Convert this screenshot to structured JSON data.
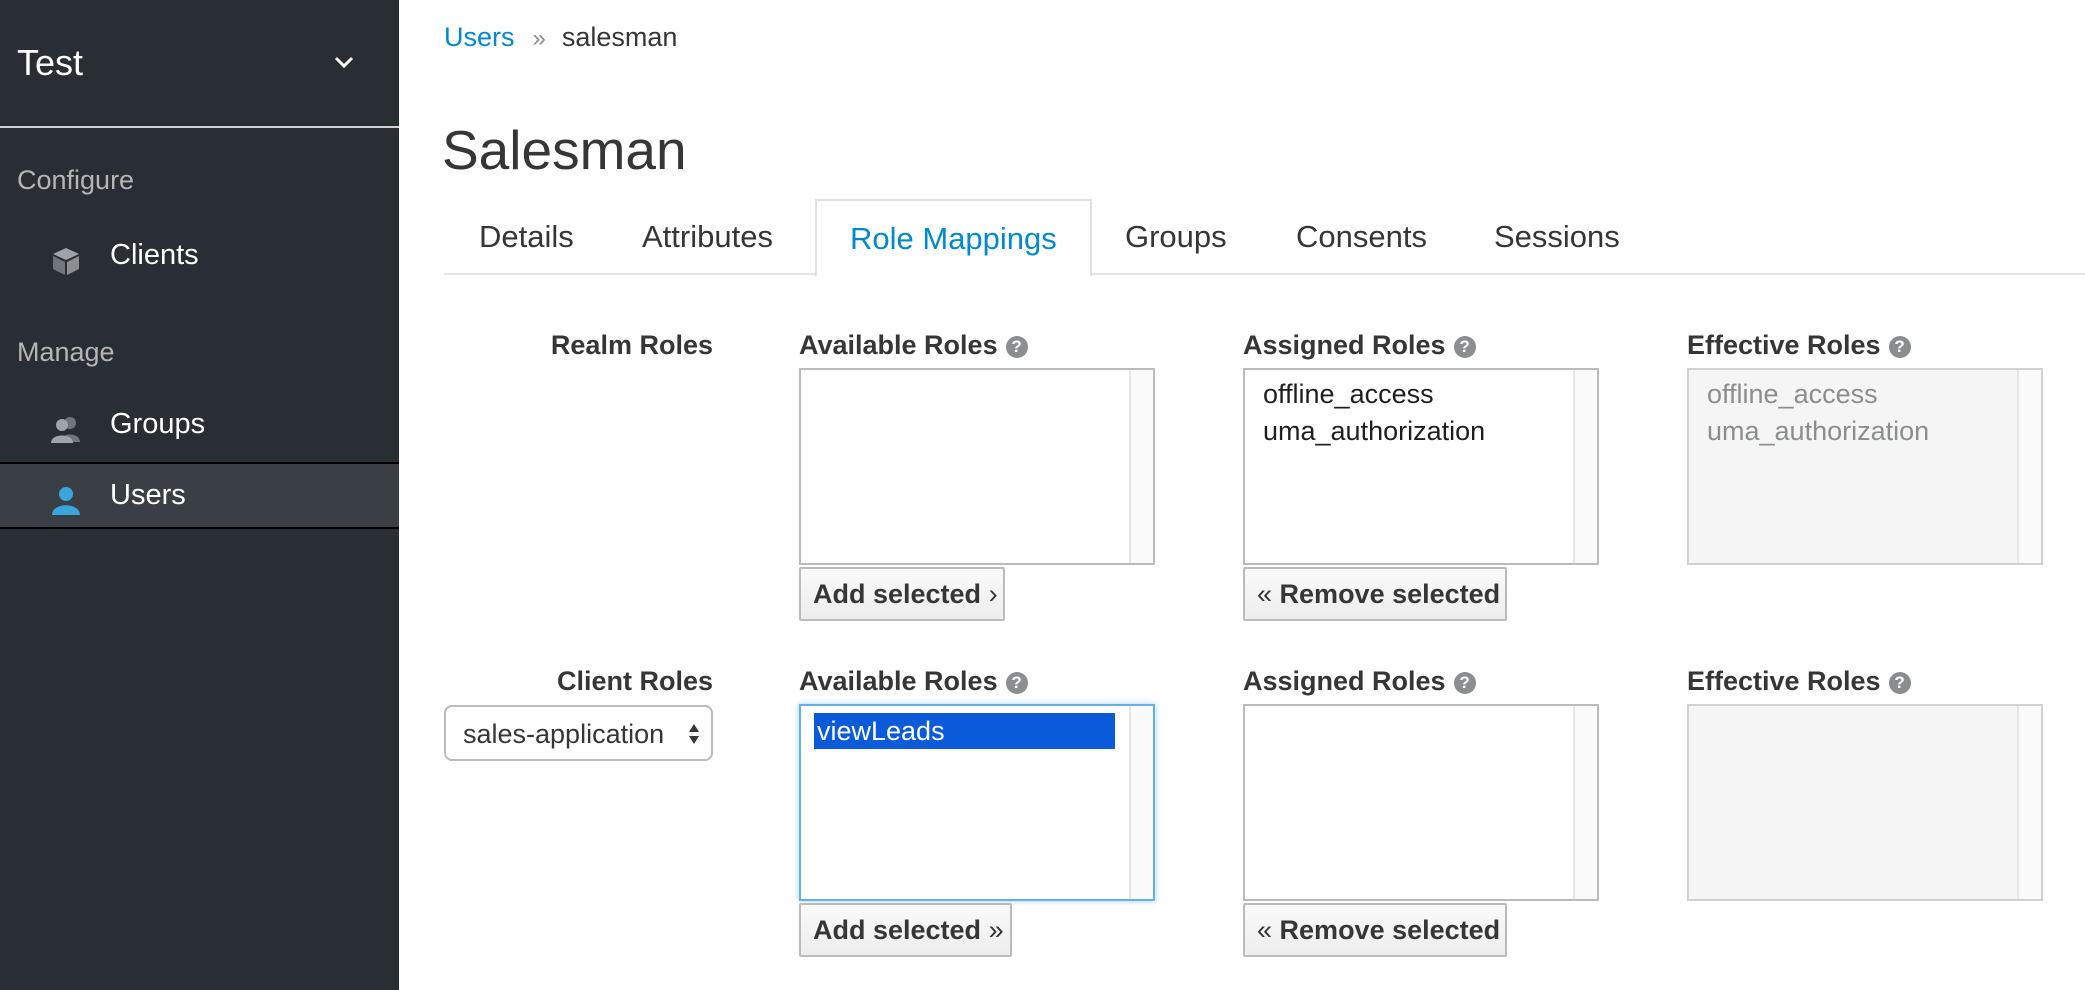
{
  "realm": {
    "name": "Test"
  },
  "nav": {
    "configure_heading": "Configure",
    "manage_heading": "Manage",
    "items": [
      {
        "label": "Clients",
        "icon": "cube-icon"
      },
      {
        "label": "Groups",
        "icon": "users-icon"
      },
      {
        "label": "Users",
        "icon": "user-icon",
        "active": true
      }
    ]
  },
  "breadcrumb": {
    "parent": "Users",
    "separator": "»",
    "current": "salesman"
  },
  "page_title": "Salesman",
  "tabs": [
    "Details",
    "Attributes",
    "Role Mappings",
    "Groups",
    "Consents",
    "Sessions"
  ],
  "active_tab": "Role Mappings",
  "help_glyph": "?",
  "realm_roles": {
    "label": "Realm Roles",
    "available": {
      "label": "Available Roles",
      "items": []
    },
    "assigned": {
      "label": "Assigned Roles",
      "items": [
        "offline_access",
        "uma_authorization"
      ]
    },
    "effective": {
      "label": "Effective Roles",
      "items": [
        "offline_access",
        "uma_authorization"
      ]
    },
    "add_button": {
      "label": "Add selected",
      "glyph": "›"
    },
    "remove_button": {
      "label": "Remove selected",
      "glyph": "«"
    }
  },
  "client_roles": {
    "label": "Client Roles",
    "client_select": {
      "value": "sales-application"
    },
    "available": {
      "label": "Available Roles",
      "items": [
        "viewLeads"
      ],
      "selected": "viewLeads"
    },
    "assigned": {
      "label": "Assigned Roles",
      "items": []
    },
    "effective": {
      "label": "Effective Roles",
      "items": []
    },
    "add_button": {
      "label": "Add selected",
      "glyph": "»"
    },
    "remove_button": {
      "label": "Remove selected",
      "glyph": "«"
    }
  },
  "colors": {
    "sidebar_bg": "#292e34",
    "active_nav_bg": "#393f44",
    "accent": "#0088ce",
    "user_icon": "#39a5dc",
    "selection": "#0a5ad9"
  }
}
